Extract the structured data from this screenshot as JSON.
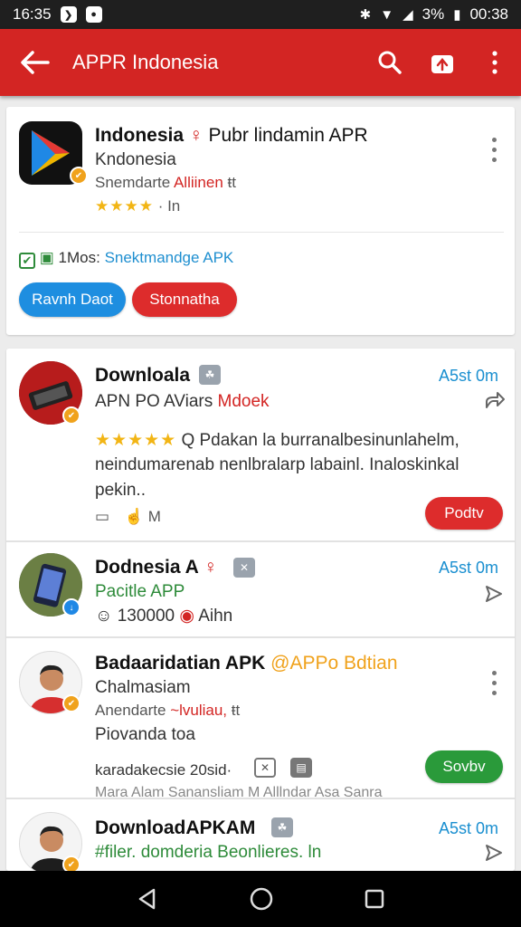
{
  "status_bar": {
    "time_left": "16:35",
    "battery": "3%",
    "time_right": "00:38"
  },
  "app_bar": {
    "title": "APPR Indonesia"
  },
  "featured": {
    "title": "Indonesia",
    "title_rest": "Pubr lindamin APR",
    "subtitle": "Kndonesia",
    "meta_gray": "Snemdarte",
    "meta_red": "Alliinen",
    "meta_tail": "ŧt",
    "stars": "★★★★",
    "rating_suffix": "· In",
    "info_prefix": "1Mos:",
    "info_link": "Snektmandge APK",
    "primary_button": "Ravnh Daot",
    "secondary_button": "Stonnatha"
  },
  "items": [
    {
      "title": "Downloala",
      "time": "A5st 0m",
      "sub_gray": "APN PO AViars",
      "sub_red": "Mdoek",
      "stars": "★★★★★",
      "desc_1": "Q  Pdakan la burranalbesinunlahelm,",
      "desc_2": "neindumarenab nenlbralarp labainl. Inaloskinkal",
      "desc_3": "pekin..",
      "foot_a": "M",
      "button": "Podtv"
    },
    {
      "title": "Dodnesia A",
      "time": "A5st 0m",
      "sub_green": "Pacitle APP",
      "stats": "130000",
      "stats_tail": "Aihn"
    },
    {
      "title": "Badaaridatian APK",
      "title_tag": "@APPo Bdtian",
      "sub": "Chalmasiam",
      "meta_gray": "Anendarte",
      "meta_red": "~lvuliau,",
      "meta_tail": "ŧt",
      "extra": "Piovanda toa",
      "foot": "karadakecsie 20sid·",
      "button": "Sovbv",
      "cut_text": "Mara Alam Sanansliam   M Alllndar Asa Sanra"
    },
    {
      "title": "DownloadAPKAM",
      "time": "A5st 0m",
      "sub_green": "#filer. domderia Beonlieres. ln"
    }
  ]
}
